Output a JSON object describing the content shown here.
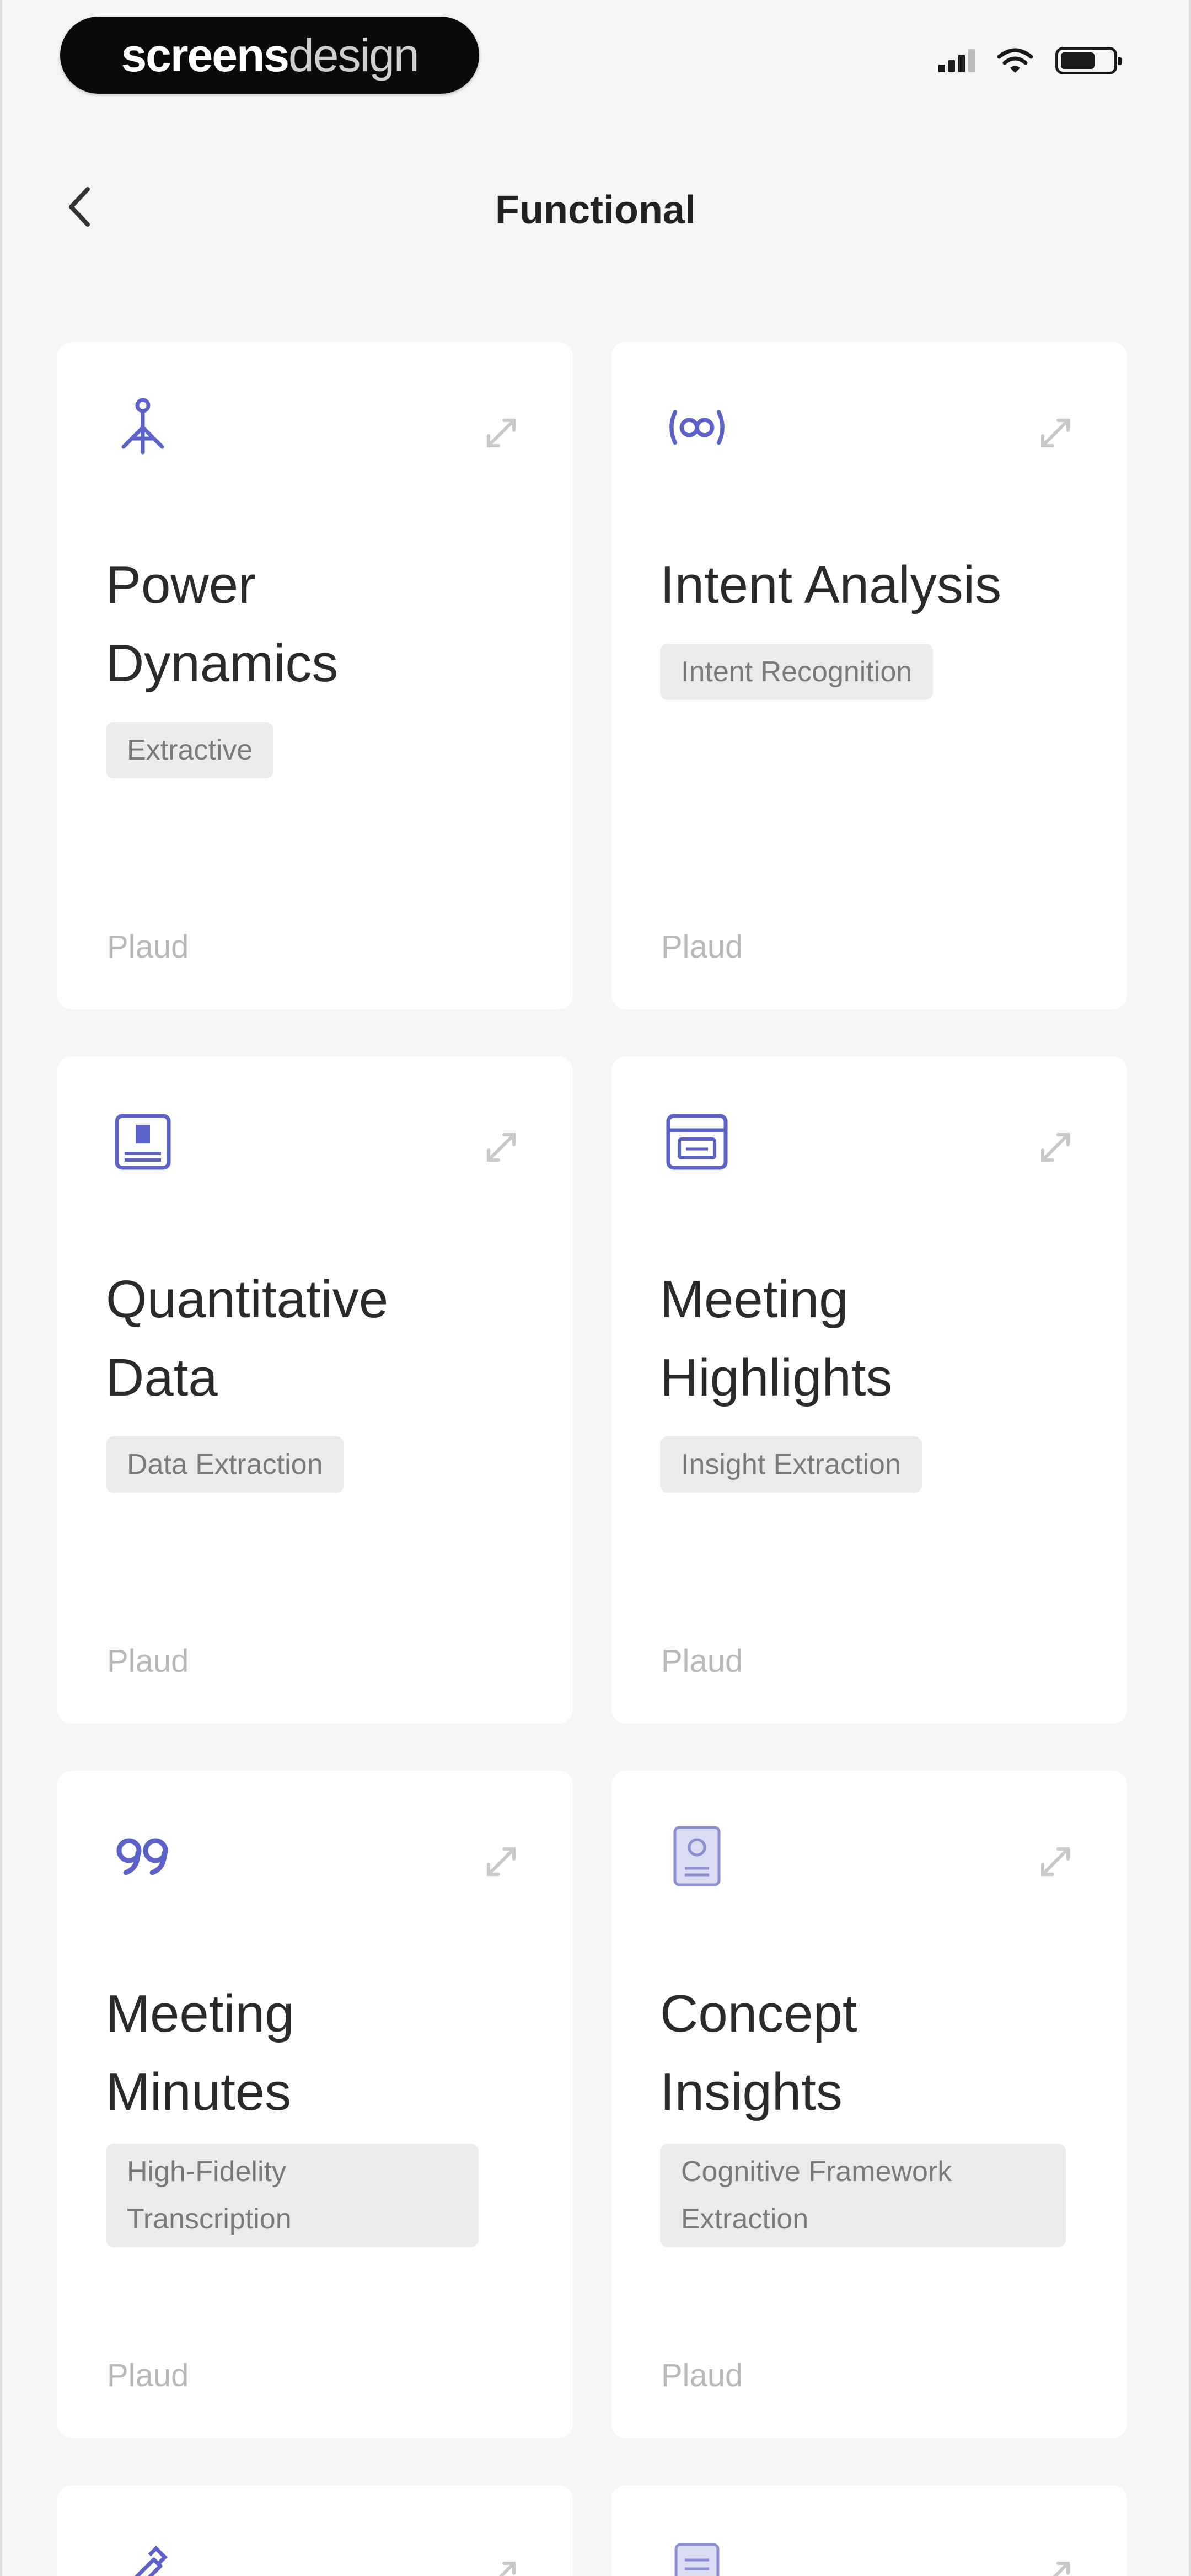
{
  "watermark": {
    "bold": "screens",
    "light": "design"
  },
  "header": {
    "title": "Functional"
  },
  "cards": [
    {
      "title": "Power Dynamics",
      "tag": "Extractive",
      "source": "Plaud",
      "icon": "tree-icon"
    },
    {
      "title": "Intent Analysis",
      "tag": "Intent Recognition",
      "source": "Plaud",
      "icon": "brackets-dots-icon"
    },
    {
      "title": "Quantitative Data",
      "tag": "Data Extraction",
      "source": "Plaud",
      "icon": "chart-board-icon"
    },
    {
      "title": "Meeting Highlights",
      "tag": "Insight Extraction",
      "source": "Plaud",
      "icon": "calendar-card-icon"
    },
    {
      "title": "Meeting Minutes",
      "tag": "High-Fidelity Transcription",
      "source": "Plaud",
      "icon": "quote-icon"
    },
    {
      "title": "Concept Insights",
      "tag": "Cognitive Framework Extraction",
      "source": "Plaud",
      "icon": "document-icon"
    }
  ],
  "colors": {
    "accent": "#5b62c8",
    "background": "#f5f5f5",
    "card": "#ffffff"
  }
}
